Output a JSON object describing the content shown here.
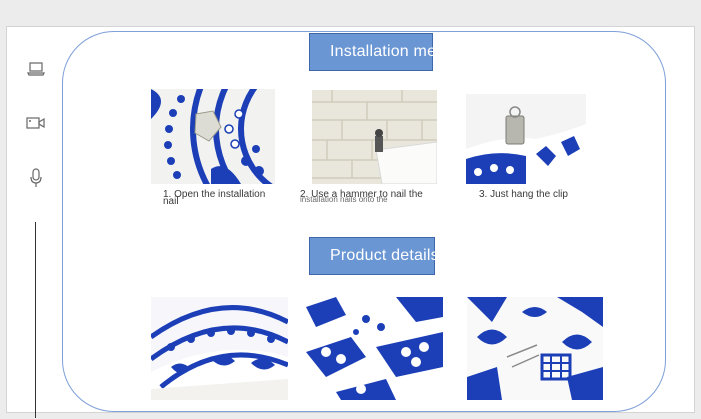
{
  "sidebar": {
    "icons": [
      "laptop-icon",
      "video-camera-icon",
      "microphone-icon"
    ]
  },
  "installation": {
    "title": "Installation method",
    "steps": [
      {
        "caption": "1. Open the installation",
        "caption_wrap": "nail"
      },
      {
        "caption": "2. Use a hammer to nail the",
        "caption_wrap": "installation nails onto the"
      },
      {
        "caption": "3. Just hang the clip"
      }
    ]
  },
  "product": {
    "title": "Product details"
  },
  "colors": {
    "accent": "#6a96d4",
    "frame": "#7e9fd8",
    "tapestry_blue": "#1c3fb7"
  }
}
